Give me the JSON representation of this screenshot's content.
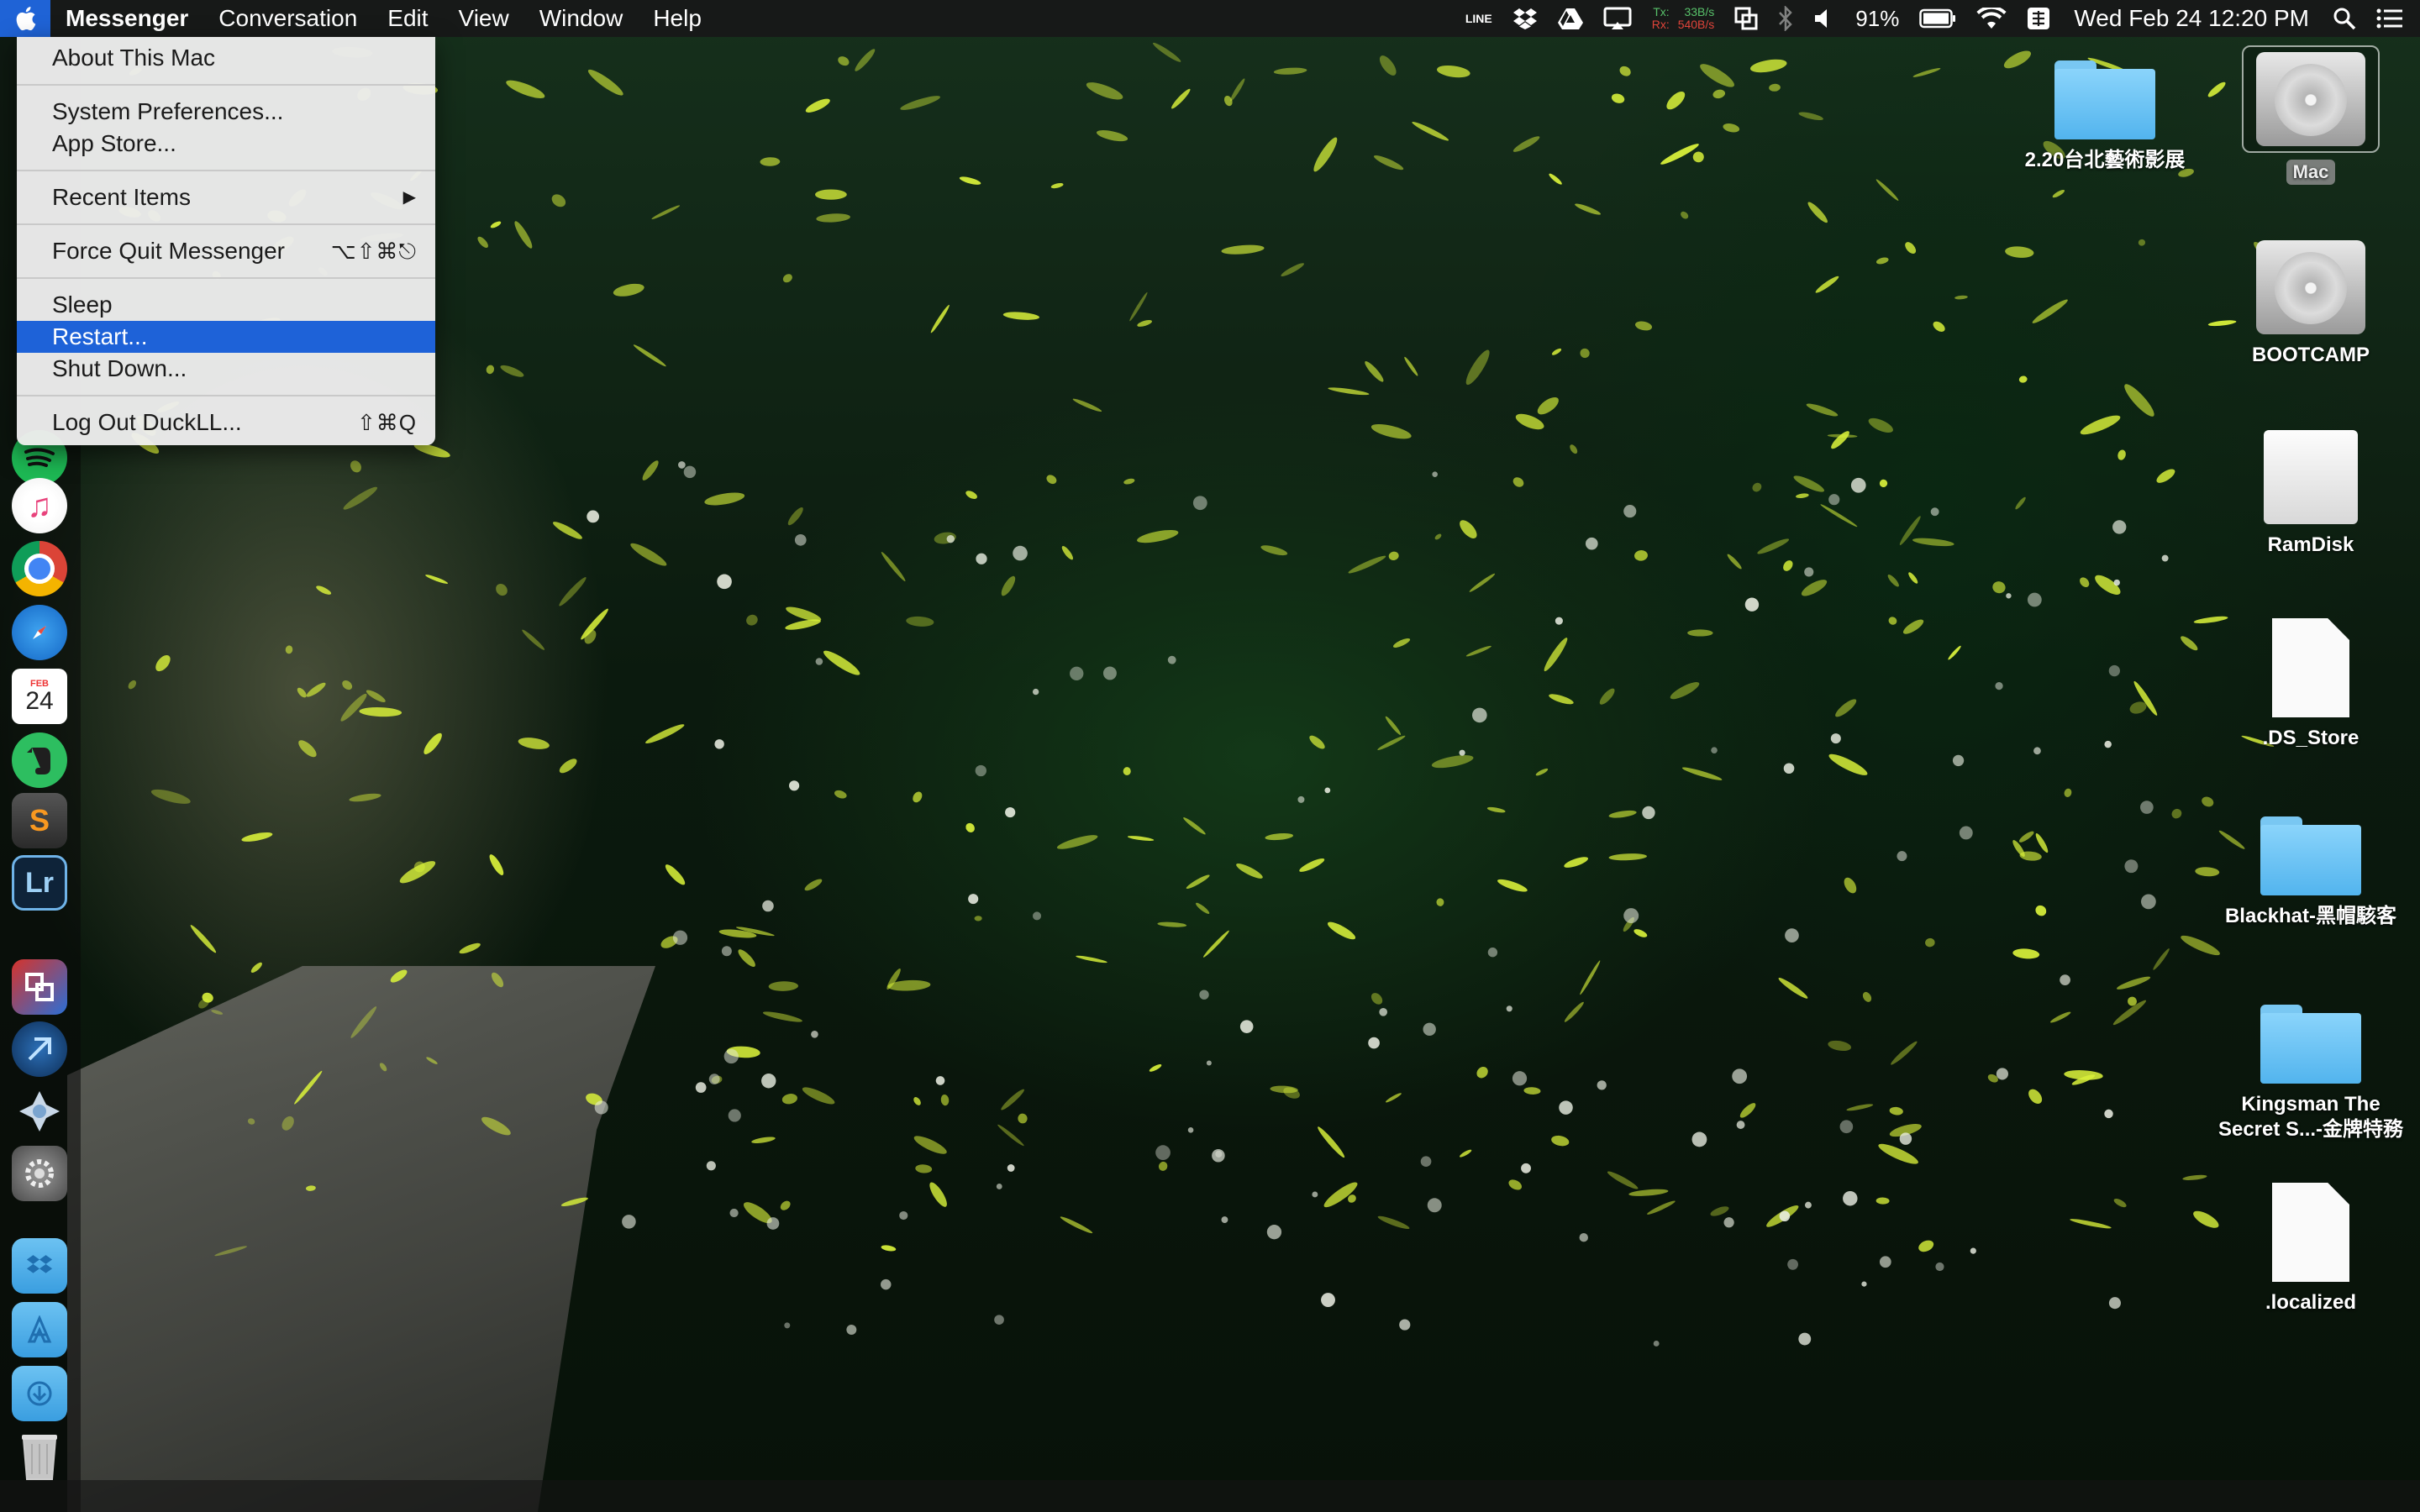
{
  "menubar": {
    "apple_glyph": "",
    "app_name": "Messenger",
    "menus": [
      "Conversation",
      "Edit",
      "View",
      "Window",
      "Help"
    ],
    "status": {
      "line": "LINE",
      "net_tx_label": "Tx:",
      "net_rx_label": "Rx:",
      "net_tx_rate": "33B/s",
      "net_rx_rate": "540B/s",
      "battery": "91%",
      "datetime": "Wed Feb 24  12:20 PM"
    }
  },
  "apple_menu": {
    "items": [
      {
        "label": "About This Mac"
      },
      {
        "label": "System Preferences..."
      },
      {
        "label": "App Store..."
      },
      {
        "label": "Recent Items",
        "submenu_arrow": "▶"
      },
      {
        "label": "Force Quit Messenger",
        "shortcut": "⌥⇧⌘⎋"
      },
      {
        "label": "Sleep"
      },
      {
        "label": "Restart...",
        "selected": true
      },
      {
        "label": "Shut Down..."
      },
      {
        "label": "Log Out DuckLL...",
        "shortcut": "⇧⌘Q"
      }
    ]
  },
  "dock": {
    "icons": [
      "spotify-icon",
      "itunes-icon",
      "chrome-icon",
      "safari-icon",
      "calendar-icon",
      "evernote-icon",
      "sublime-text-icon",
      "lightroom-icon",
      "parallels-icon",
      "xcode-icon",
      "playstation-icon",
      "system-preferences-icon",
      "dropbox-folder-icon",
      "applications-folder-icon",
      "downloads-folder-icon",
      "trash-icon"
    ],
    "calendar_month": "FEB",
    "calendar_day": "24",
    "lightroom_text": "Lr",
    "sublime_text": "S"
  },
  "desktop": {
    "items": [
      {
        "label": "2.20台北藝術影展"
      },
      {
        "label": "Mac"
      },
      {
        "label": "BOOTCAMP"
      },
      {
        "label": "RamDisk"
      },
      {
        "label": ".DS_Store"
      },
      {
        "label": "Blackhat-黑帽駭客"
      },
      {
        "label": "Kingsman The Secret S...-金牌特務"
      },
      {
        "label": ".localized"
      }
    ]
  },
  "colors": {
    "menu_highlight": "#1e62d8",
    "folder_blue": "#6ec6f5",
    "firefly": "#d8f03a"
  }
}
